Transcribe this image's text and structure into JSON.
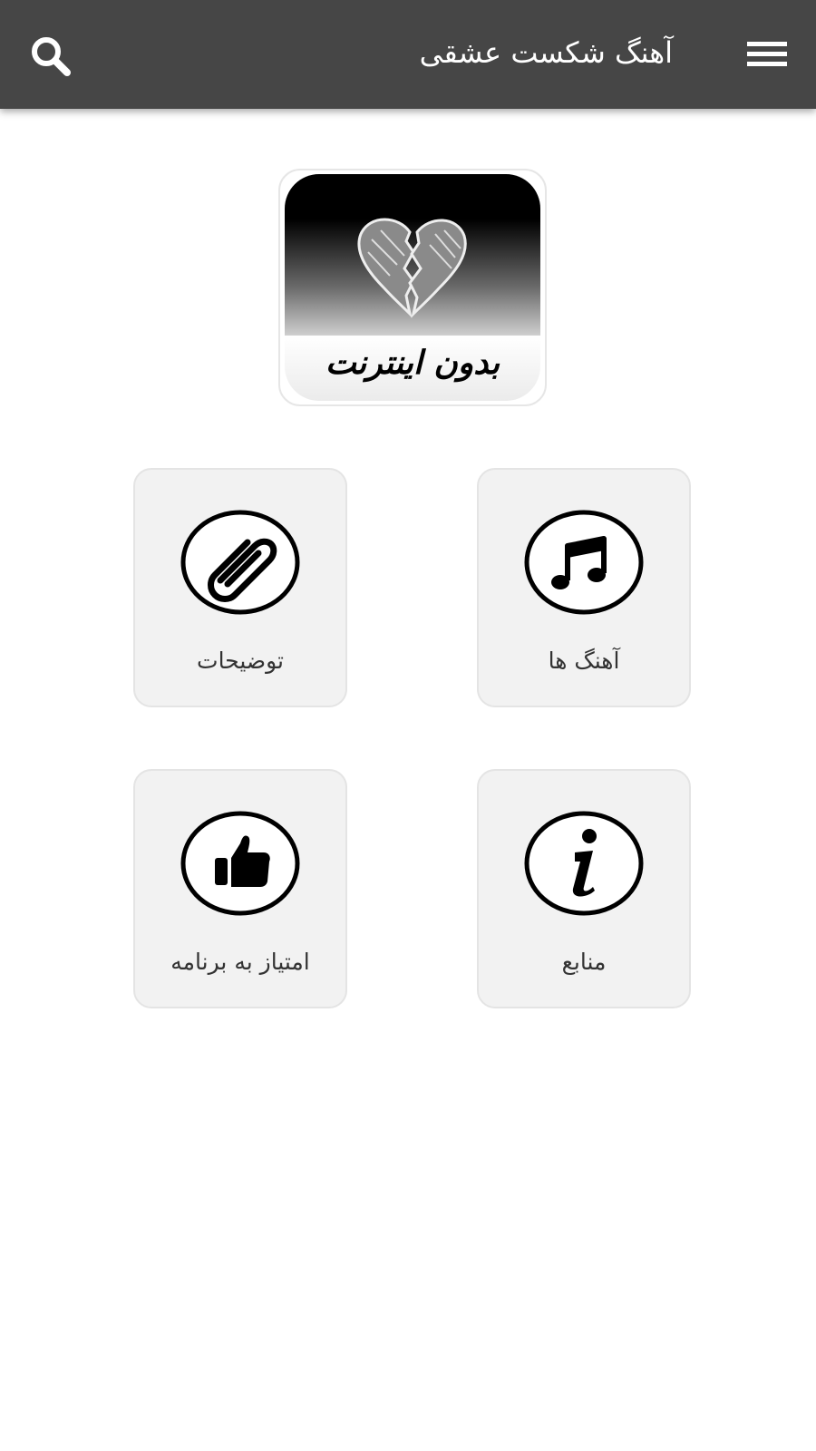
{
  "header": {
    "title": "آهنگ شکست عشقی",
    "menu_icon": "hamburger-menu-icon",
    "search_icon": "search-icon",
    "background_color": "#464646"
  },
  "logo": {
    "text": "بدون اینترنت",
    "icon": "broken-heart-icon"
  },
  "tiles": [
    {
      "label": "آهنگ ها",
      "icon": "music-note-icon"
    },
    {
      "label": "توضیحات",
      "icon": "paperclip-icon"
    },
    {
      "label": "منابع",
      "icon": "info-icon"
    },
    {
      "label": "امتیاز به برنامه",
      "icon": "thumbs-up-icon"
    }
  ]
}
